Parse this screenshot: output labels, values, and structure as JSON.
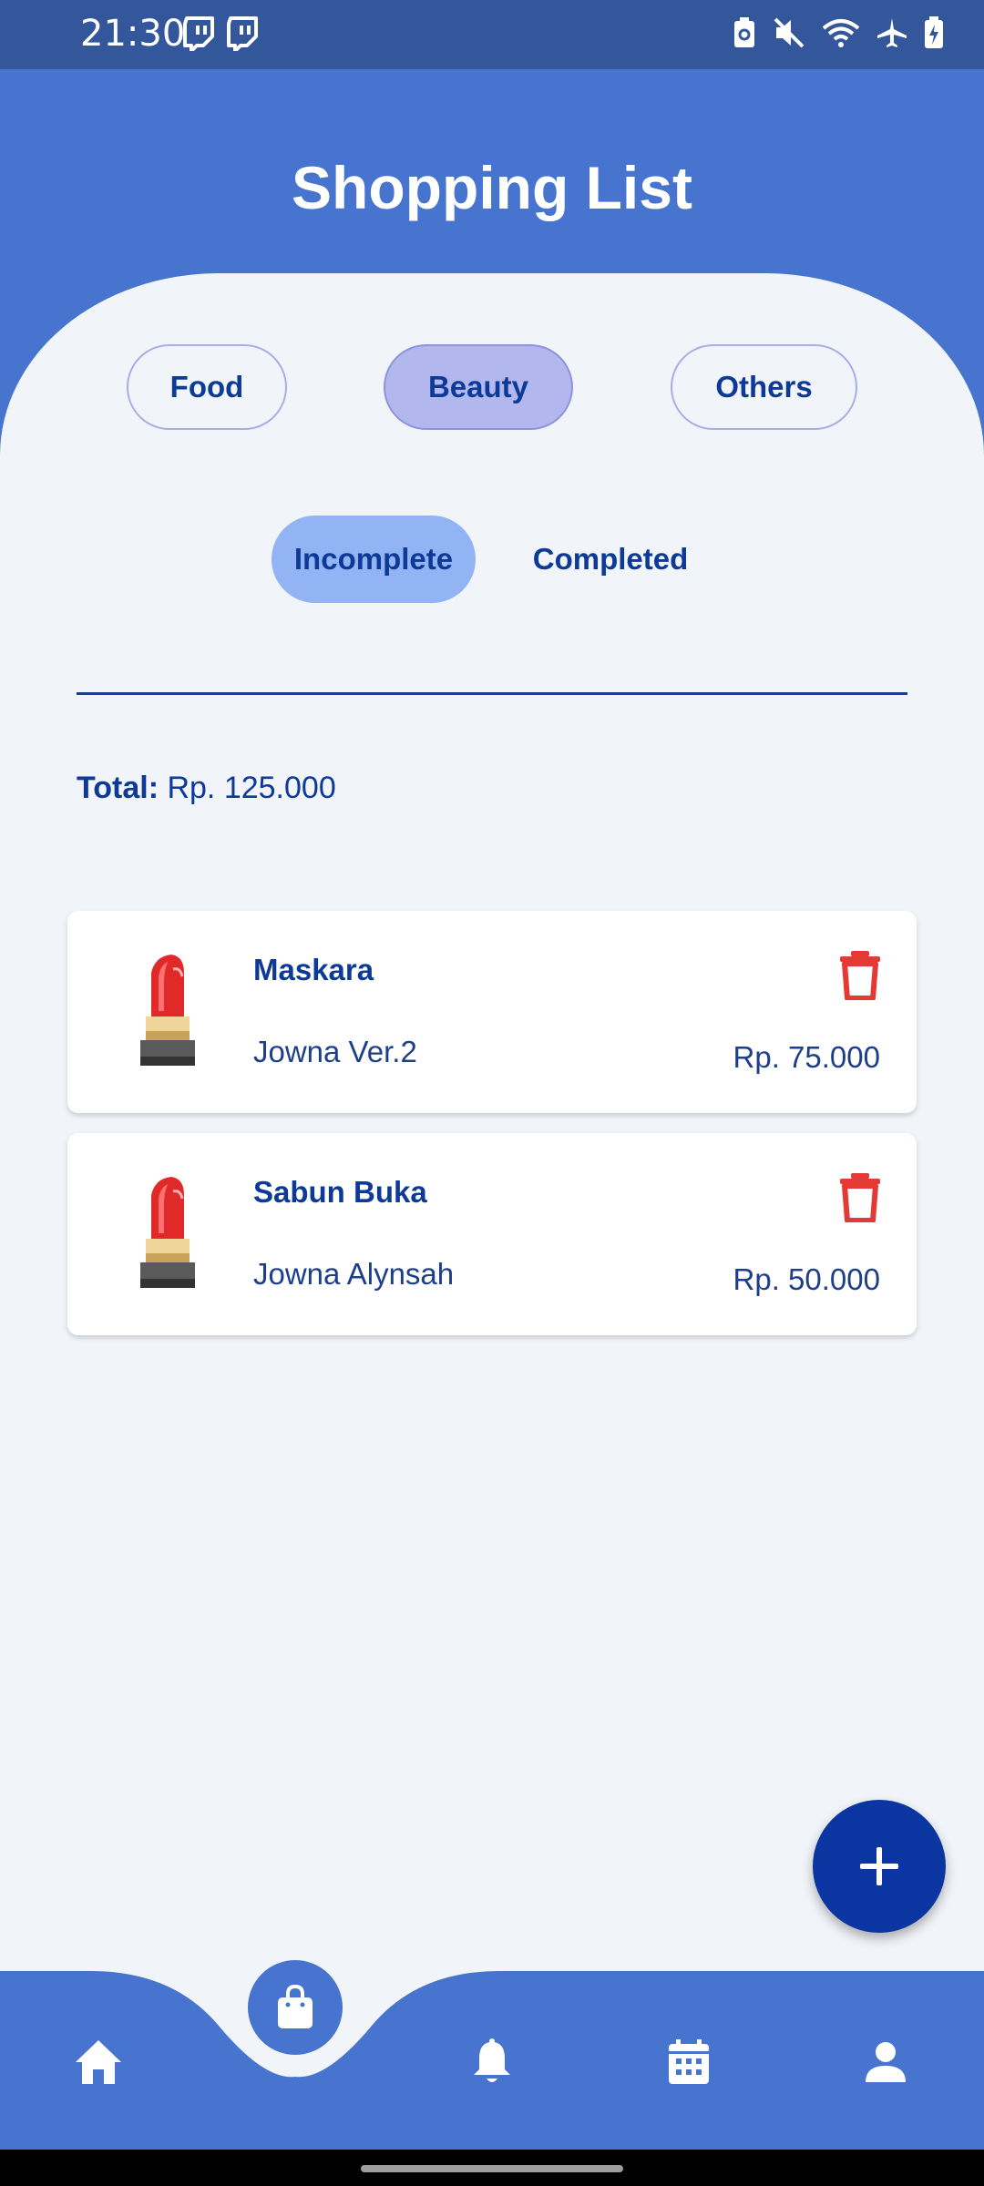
{
  "status_bar": {
    "time": "21:30",
    "left_icons": [
      "twitch-icon",
      "twitch-icon"
    ],
    "right_icons": [
      "battery-saver-icon",
      "mute-icon",
      "wifi-icon",
      "airplane-icon",
      "battery-charging-icon"
    ]
  },
  "header": {
    "title": "Shopping List"
  },
  "categories": [
    {
      "label": "Food",
      "active": false
    },
    {
      "label": "Beauty",
      "active": true
    },
    {
      "label": "Others",
      "active": false
    }
  ],
  "status_tabs": [
    {
      "label": "Incomplete",
      "active": true
    },
    {
      "label": "Completed",
      "active": false
    }
  ],
  "total": {
    "label": "Total:",
    "value": "Rp. 125.000"
  },
  "items": [
    {
      "name": "Maskara",
      "description": "Jowna Ver.2",
      "price": "Rp. 75.000",
      "icon": "lipstick-icon"
    },
    {
      "name": "Sabun Buka",
      "description": "Jowna Alynsah",
      "price": "Rp. 50.000",
      "icon": "lipstick-icon"
    }
  ],
  "fab": {
    "icon": "plus-icon"
  },
  "bottom_nav": {
    "items": [
      "home-icon",
      "shopping-bag-icon",
      "bell-icon",
      "calendar-icon",
      "profile-icon"
    ],
    "active": "shopping-bag-icon"
  },
  "colors": {
    "primary": "#4674CE",
    "status_bar": "#34569A",
    "background": "#F1F4F9",
    "text_dark_blue": "#0D3A96",
    "active_tab": "#93B4F4",
    "active_category": "#B2B7EE",
    "fab": "#0B35A0",
    "delete": "#E53935"
  }
}
